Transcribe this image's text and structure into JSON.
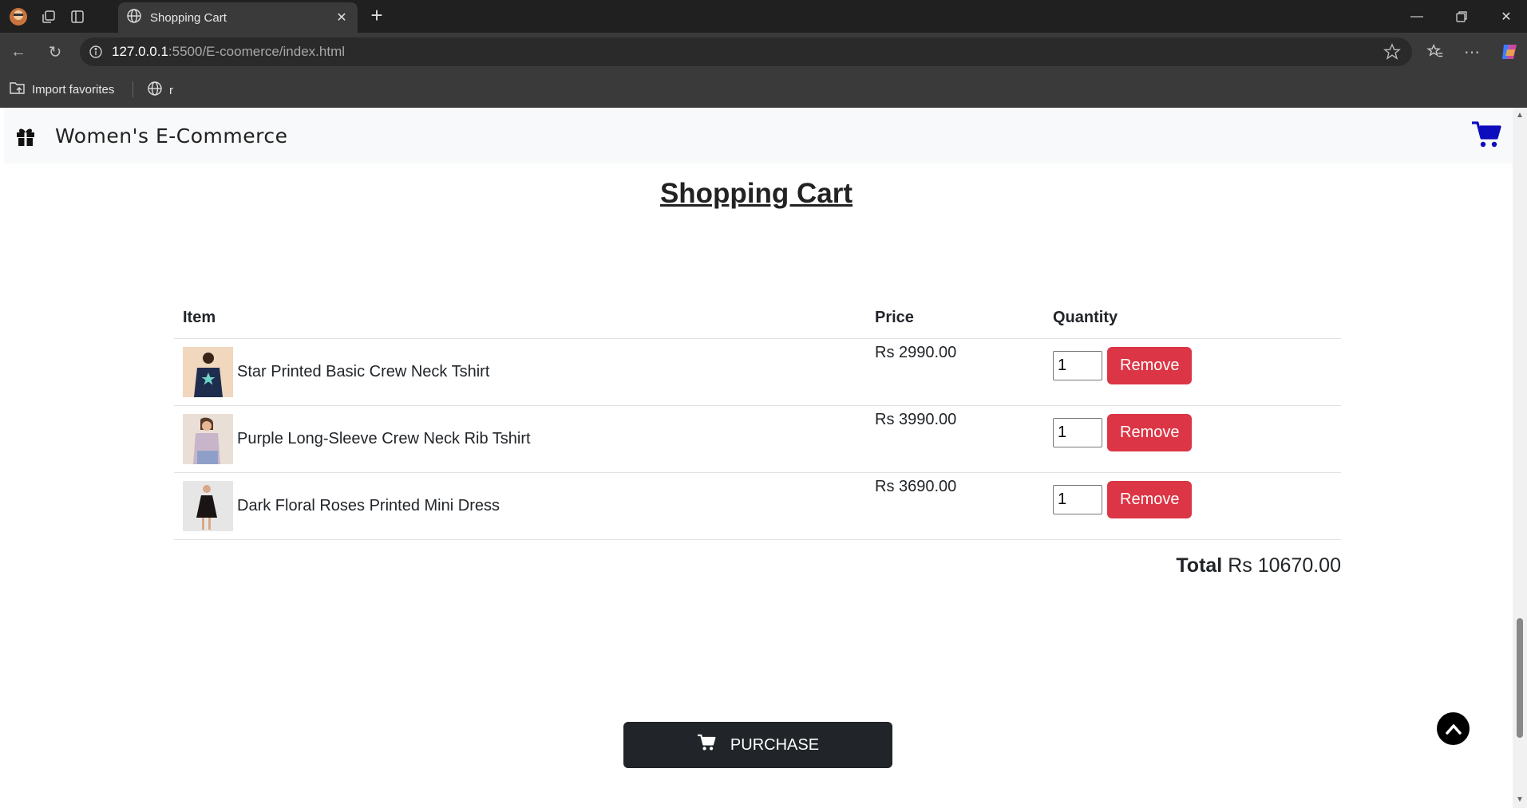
{
  "browser": {
    "tab_title": "Shopping Cart",
    "url_host": "127.0.0.1",
    "url_path": ":5500/E-coomerce/index.html",
    "bookmarks": [
      {
        "label": "Import favorites"
      },
      {
        "label": "r"
      }
    ]
  },
  "navbar": {
    "brand": "Women's E-Commerce",
    "icons": {
      "brand": "gift-icon",
      "cart": "shopping-cart-icon"
    },
    "cart_color": "#0d0dbd"
  },
  "page": {
    "title": "Shopping Cart"
  },
  "cart": {
    "headers": {
      "item": "Item",
      "price": "Price",
      "quantity": "Quantity"
    },
    "remove_label": "Remove",
    "rows": [
      {
        "name": "Star Printed Basic Crew Neck Tshirt",
        "price": "Rs 2990.00",
        "qty": "1"
      },
      {
        "name": "Purple Long-Sleeve Crew Neck Rib Tshirt",
        "price": "Rs 3990.00",
        "qty": "1"
      },
      {
        "name": "Dark Floral Roses Printed Mini Dress",
        "price": "Rs 3690.00",
        "qty": "1"
      }
    ],
    "total_label": "Total",
    "total_value": "Rs 10670.00"
  },
  "actions": {
    "purchase_label": "PURCHASE"
  },
  "colors": {
    "remove": "#dc3545",
    "purchase": "#212529"
  }
}
